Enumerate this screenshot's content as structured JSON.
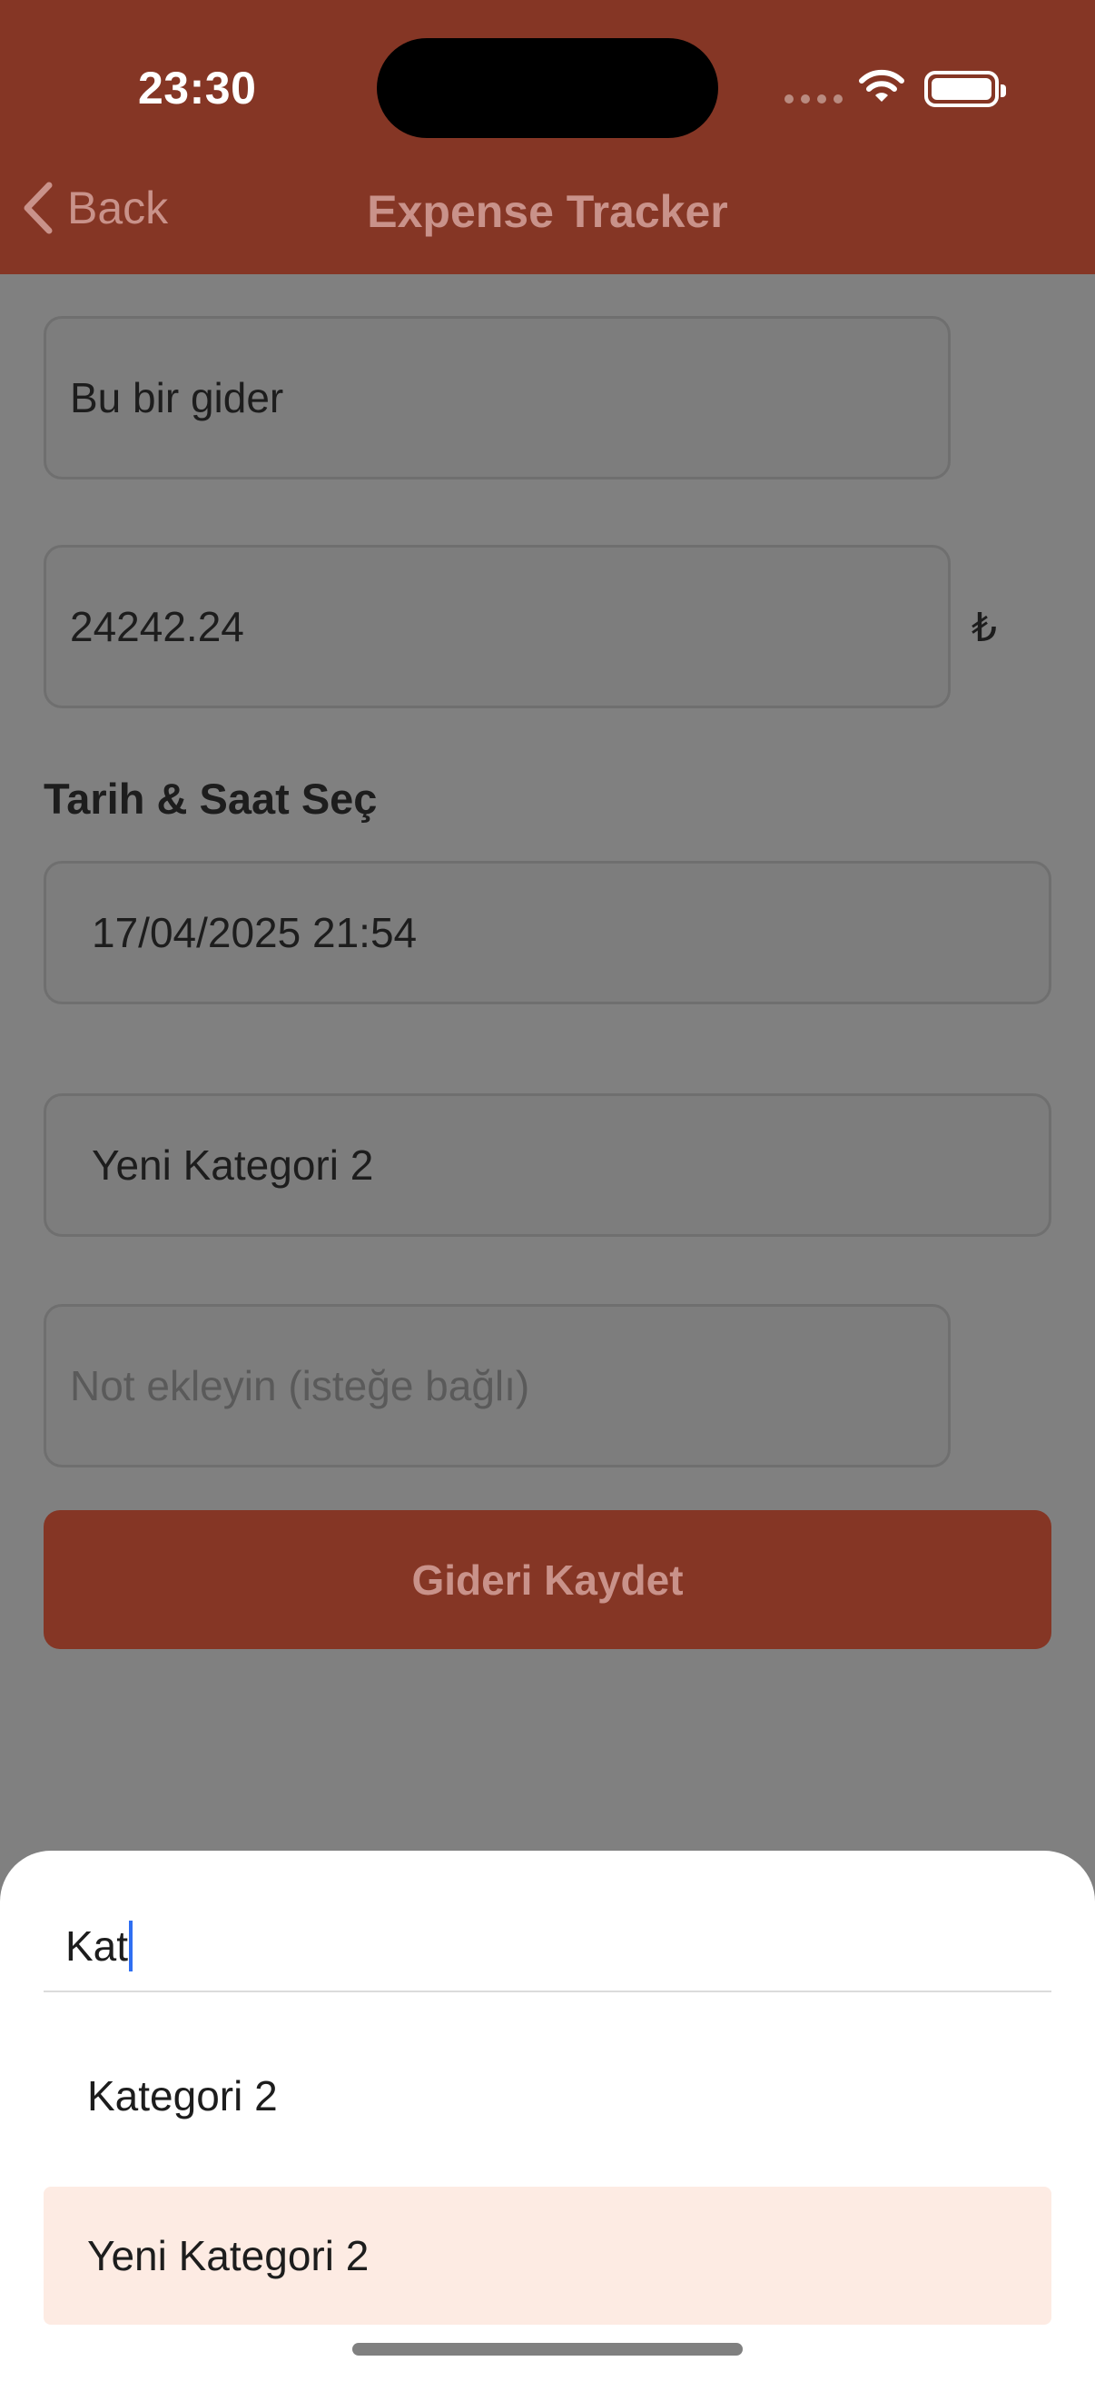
{
  "status_bar": {
    "time": "23:30"
  },
  "nav": {
    "back_label": "Back",
    "title": "Expense Tracker"
  },
  "form": {
    "description_value": "Bu bir gider",
    "amount_value": "24242.24",
    "currency_symbol": "₺",
    "datetime_label": "Tarih & Saat Seç",
    "datetime_value": "17/04/2025 21:54",
    "category_value": "Yeni Kategori 2",
    "note_placeholder": "Not ekleyin (isteğe bağlı)",
    "save_label": "Gideri Kaydet"
  },
  "sheet": {
    "search_value": "Kat",
    "options": [
      {
        "label": "Kategori 2",
        "selected": false
      },
      {
        "label": "Yeni Kategori 2",
        "selected": true
      }
    ]
  },
  "colors": {
    "brand": "#853625",
    "selected_bg": "#fdebe3",
    "caret": "#2f6ff2"
  }
}
